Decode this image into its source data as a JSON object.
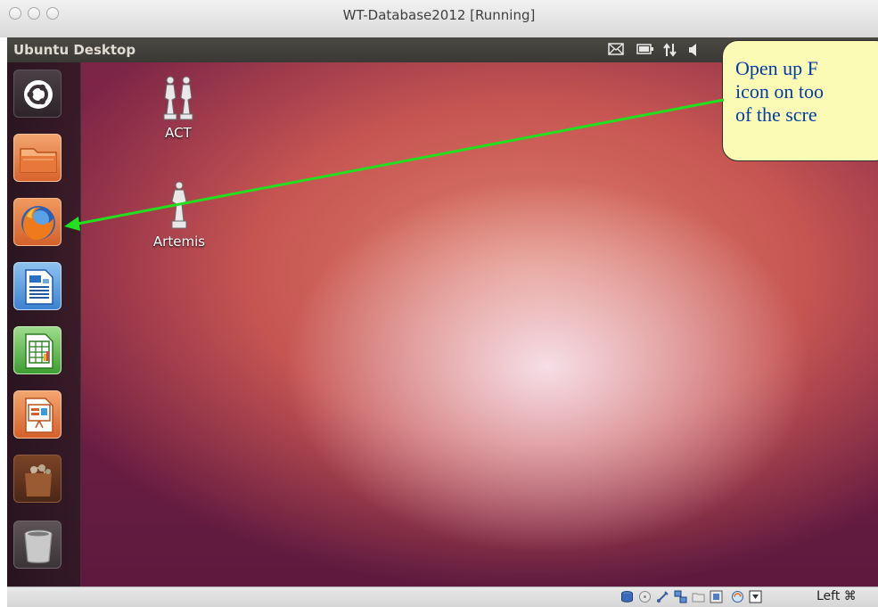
{
  "window": {
    "title": "WT-Database2012 [Running]"
  },
  "panel": {
    "title": "Ubuntu Desktop",
    "tray_icons": [
      "mail-icon",
      "battery-icon",
      "network-icon",
      "volume-icon"
    ]
  },
  "launcher": {
    "items": [
      {
        "name": "dash-home",
        "icon": "ubuntu-logo-icon"
      },
      {
        "name": "files",
        "icon": "folder-icon"
      },
      {
        "name": "firefox",
        "icon": "firefox-icon"
      },
      {
        "name": "libreoffice-writer",
        "icon": "writer-icon"
      },
      {
        "name": "libreoffice-calc",
        "icon": "calc-icon"
      },
      {
        "name": "libreoffice-impress",
        "icon": "impress-icon"
      },
      {
        "name": "software-center",
        "icon": "shopping-bag-icon"
      },
      {
        "name": "trash",
        "icon": "trash-icon"
      }
    ]
  },
  "desktop_icons": [
    {
      "label": "ACT",
      "icon": "statues-icon"
    },
    {
      "label": "Artemis",
      "icon": "statue-icon"
    }
  ],
  "callout": {
    "lines": [
      "Open up F",
      "icon on too",
      "of the scre"
    ],
    "arrow_color": "#22e01e"
  },
  "statusbar": {
    "icons": [
      "hard-disk-icon",
      "optical-disk-icon",
      "usb-icon",
      "network-adapters-icon",
      "shared-folders-icon",
      "display-icon",
      "capture-icon",
      "mouse-integration-icon"
    ],
    "host_key": "Left ⌘"
  },
  "colors": {
    "panel": "#3c3b37",
    "callout_bg": "#fcfbb5",
    "callout_text": "#003ba8",
    "wallpaper": "#c65552"
  }
}
